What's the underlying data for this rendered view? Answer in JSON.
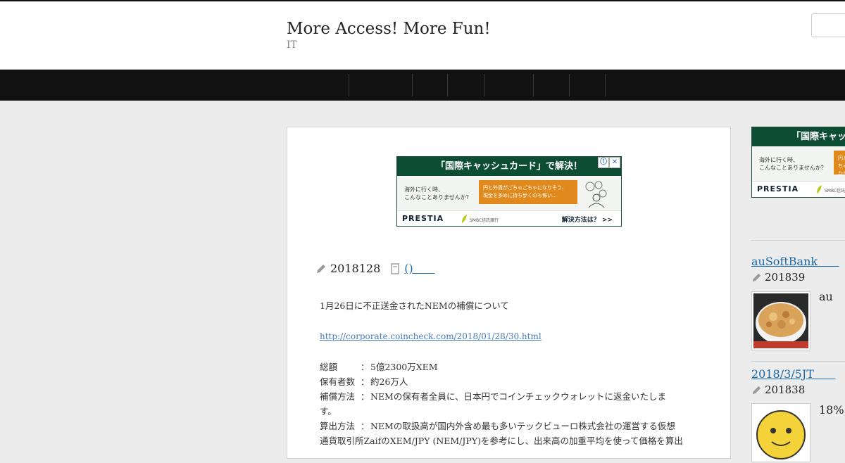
{
  "header": {
    "site_title": "More Access! More Fun!",
    "site_desc": "IT"
  },
  "ad": {
    "headline": "「国際キャッシュカード」で解決！",
    "left_line1": "海外に行く時、",
    "left_line2": "こんなことありませんか？",
    "orange_line1": "円と外貨がごちゃごちゃになりそう、",
    "orange_line2": "現金を多めに持ち歩くのも怖い…",
    "brand": "PRESTIA",
    "bank": "SMBC信託銀行",
    "cta": "解決方法は？ >>",
    "info_icon": "ⓘ",
    "close_icon": "✕"
  },
  "post": {
    "date": "2018128",
    "category_link": "()"
  },
  "article": {
    "line1": "1月26日に不正送金されたNEMの補償について",
    "link": "http://corporate.coincheck.com/2018/01/28/30.html",
    "rows": [
      {
        "k": "総額",
        "v": "5億2300万XEM"
      },
      {
        "k": "保有者数",
        "v": "約26万人"
      },
      {
        "k": "補償方法",
        "v": "NEMの保有者全員に、日本円でコインチェックウォレットに返金いたしま"
      }
    ],
    "row3_cont": "す。",
    "row4_k": "算出方法",
    "row4_v": "NEMの取扱高が国内外含め最も多いテックビューロ株式会社の運営する仮想",
    "row4_cont": "通貨取引所ZaifのXEM/JPY (NEM/JPY)を参考にし、出来高の加重平均を使って価格を算出"
  },
  "sidebar": {
    "post1_title": "auSoftBank",
    "post1_date": "201839",
    "post1_excerpt": "au",
    "post2_title": "2018/3/5JT",
    "post2_date": "201838",
    "post2_excerpt": "18%"
  },
  "colors": {
    "nav_bg": "#111111",
    "link": "#1a6aa8",
    "ad_green": "#0d4d36",
    "ad_orange": "#e08a1e"
  }
}
